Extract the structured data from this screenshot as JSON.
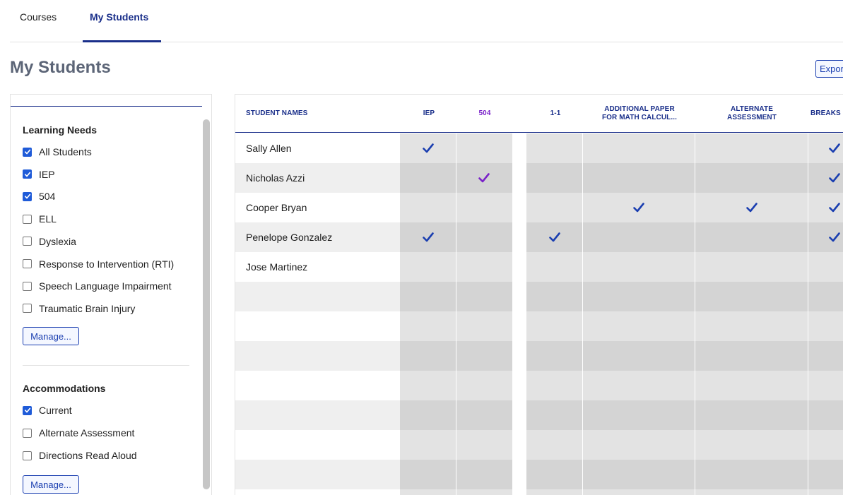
{
  "nav": {
    "tabs": [
      {
        "label": "Courses",
        "active": false
      },
      {
        "label": "My Students",
        "active": true
      }
    ]
  },
  "page": {
    "title": "My Students",
    "export_label": "Export"
  },
  "sidebar": {
    "learning_needs": {
      "title": "Learning Needs",
      "items": [
        {
          "label": "All Students",
          "checked": true
        },
        {
          "label": "IEP",
          "checked": true
        },
        {
          "label": "504",
          "checked": true
        },
        {
          "label": "ELL",
          "checked": false
        },
        {
          "label": "Dyslexia",
          "checked": false
        },
        {
          "label": "Response to Intervention (RTI)",
          "checked": false
        },
        {
          "label": "Speech Language Impairment",
          "checked": false
        },
        {
          "label": "Traumatic Brain Injury",
          "checked": false
        }
      ],
      "manage_label": "Manage..."
    },
    "accommodations": {
      "title": "Accommodations",
      "items": [
        {
          "label": "Current",
          "checked": true
        },
        {
          "label": "Alternate Assessment",
          "checked": false
        },
        {
          "label": "Directions Read Aloud",
          "checked": false
        }
      ],
      "manage_label": "Manage..."
    }
  },
  "table": {
    "headers": {
      "student_names": "STUDENT NAMES",
      "iep": "IEP",
      "s504": "504",
      "one_to_one": "1-1",
      "additional_paper_line1": "ADDITIONAL PAPER",
      "additional_paper_line2": "FOR MATH CALCUL...",
      "alternate_line1": "ALTERNATE",
      "alternate_line2": "ASSESSMENT",
      "breaks": "BREAKS"
    },
    "rows": [
      {
        "name": "Sally Allen",
        "iep": true,
        "s504": false,
        "one_to_one": false,
        "additional_paper": false,
        "alternate": false,
        "breaks": true
      },
      {
        "name": "Nicholas Azzi",
        "iep": false,
        "s504": true,
        "one_to_one": false,
        "additional_paper": false,
        "alternate": false,
        "breaks": true
      },
      {
        "name": "Cooper Bryan",
        "iep": false,
        "s504": false,
        "one_to_one": false,
        "additional_paper": true,
        "alternate": true,
        "breaks": true
      },
      {
        "name": "Penelope Gonzalez",
        "iep": true,
        "s504": false,
        "one_to_one": true,
        "additional_paper": false,
        "alternate": false,
        "breaks": true
      },
      {
        "name": "Jose Martinez",
        "iep": false,
        "s504": false,
        "one_to_one": false,
        "additional_paper": false,
        "alternate": false,
        "breaks": false
      }
    ],
    "empty_rows": 7
  },
  "colors": {
    "accent": "#1a2f8a",
    "check_blue": "#1a3eb0",
    "check_purple": "#7a22c9",
    "checkbox_blue": "#1f5bd8"
  },
  "icons": {
    "check": "check-icon",
    "checkbox": "checkbox-icon"
  }
}
